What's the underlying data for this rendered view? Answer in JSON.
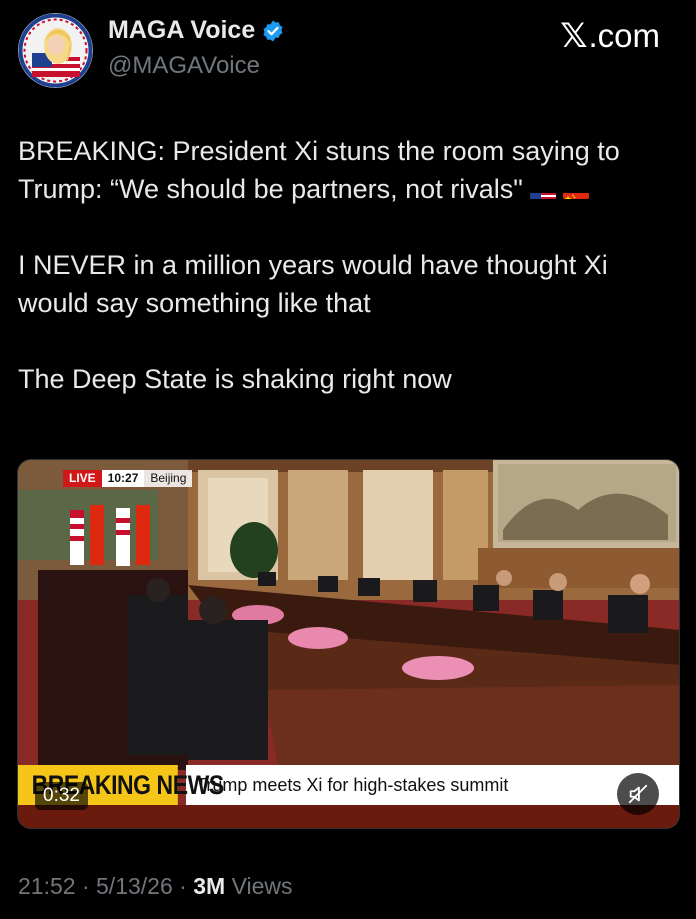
{
  "author": {
    "display_name": "MAGA Voice",
    "handle": "@MAGAVoice",
    "verified": true
  },
  "site": {
    "logo_mark": "𝕏",
    "logo_text": ".com"
  },
  "tweet": {
    "paragraphs": [
      "BREAKING: President Xi stuns the room saying to Trump: “We should be partners, not rivals\"",
      "I NEVER in a million years would have thought Xi would say something like that",
      "The Deep State is shaking right now"
    ],
    "flags": [
      "us-flag-icon",
      "china-flag-icon"
    ]
  },
  "media": {
    "live_label": "LIVE",
    "live_time": "10:27",
    "live_location": "Beijing",
    "banner_label": "BREAKING NEWS",
    "banner_headline": "Trump meets Xi for high-stakes summit",
    "duration": "0:32",
    "muted": true
  },
  "footer": {
    "time": "21:52",
    "date": "5/13/26",
    "views_count": "3M",
    "views_label": "Views",
    "separator": "·"
  },
  "colors": {
    "background": "#000000",
    "text_primary": "#e7e9ea",
    "text_secondary": "#71767b",
    "verified_blue": "#1d9bf0",
    "breaking_yellow": "#f5c518",
    "live_red": "#d01818"
  }
}
